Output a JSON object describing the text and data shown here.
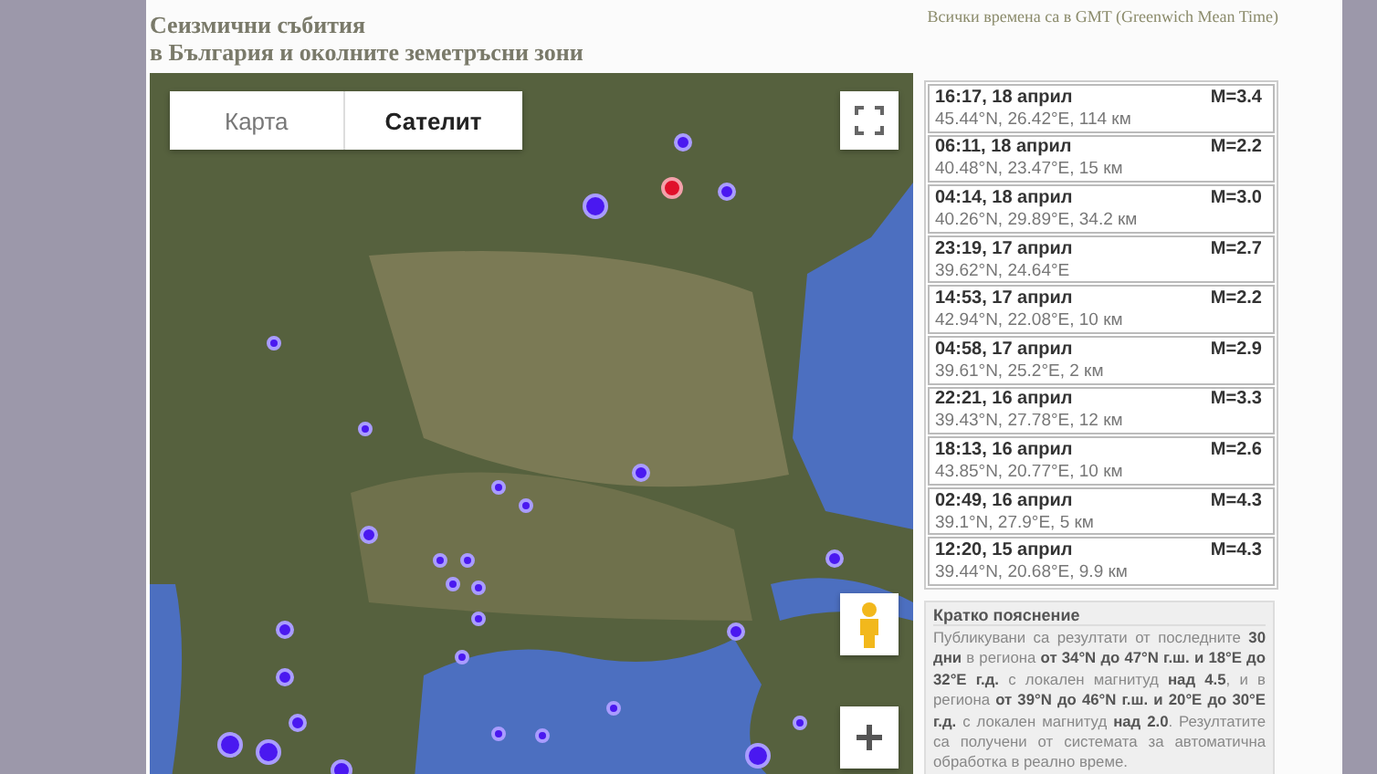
{
  "header": {
    "title_line_1": "Сеизмични събития",
    "title_line_2": "в България и околните земетръсни зони",
    "time_note": "Всички времена са в GMT (Greenwich Mean Time)"
  },
  "map": {
    "map_types": [
      {
        "label": "Карта",
        "selected": false
      },
      {
        "label": "Сателит",
        "selected": true
      }
    ]
  },
  "events": [
    {
      "time": "16:17, 18 април",
      "magnitude": "M=3.4",
      "location": "45.44°N, 26.42°E, 114 км"
    },
    {
      "time": "06:11, 18 април",
      "magnitude": "M=2.2",
      "location": "40.48°N, 23.47°E, 15 км"
    },
    {
      "time": "04:14, 18 април",
      "magnitude": "M=3.0",
      "location": "40.26°N, 29.89°E, 34.2 км"
    },
    {
      "time": "23:19, 17 април",
      "magnitude": "M=2.7",
      "location": "39.62°N, 24.64°E"
    },
    {
      "time": "14:53, 17 април",
      "magnitude": "M=2.2",
      "location": "42.94°N, 22.08°E, 10 км"
    },
    {
      "time": "04:58, 17 април",
      "magnitude": "M=2.9",
      "location": "39.61°N, 25.2°E, 2 км"
    },
    {
      "time": "22:21, 16 април",
      "magnitude": "M=3.3",
      "location": "39.43°N, 27.78°E, 12 км"
    },
    {
      "time": "18:13, 16 април",
      "magnitude": "M=2.6",
      "location": "43.85°N, 20.77°E, 10 км"
    },
    {
      "time": "02:49, 16 април",
      "magnitude": "M=4.3",
      "location": "39.1°N, 27.9°E, 5 км"
    },
    {
      "time": "12:20, 15 април",
      "magnitude": "M=4.3",
      "location": "39.44°N, 20.68°E, 9.9 км"
    }
  ],
  "explanation": {
    "title": "Кратко пояснение",
    "text": "Публикувани са резултати от последните **30 дни** в региона **от 34°N до 47°N г.ш. и 18°E до 32°E г.д.** с локален магнитуд **над 4.5**, и в региона **от 39°N до 46°N г.ш. и 20°E до 30°E г.д.** с локален магнитуд **над 2.0**. Резултатите са получени от системата за автоматична обработка в реално време."
  }
}
